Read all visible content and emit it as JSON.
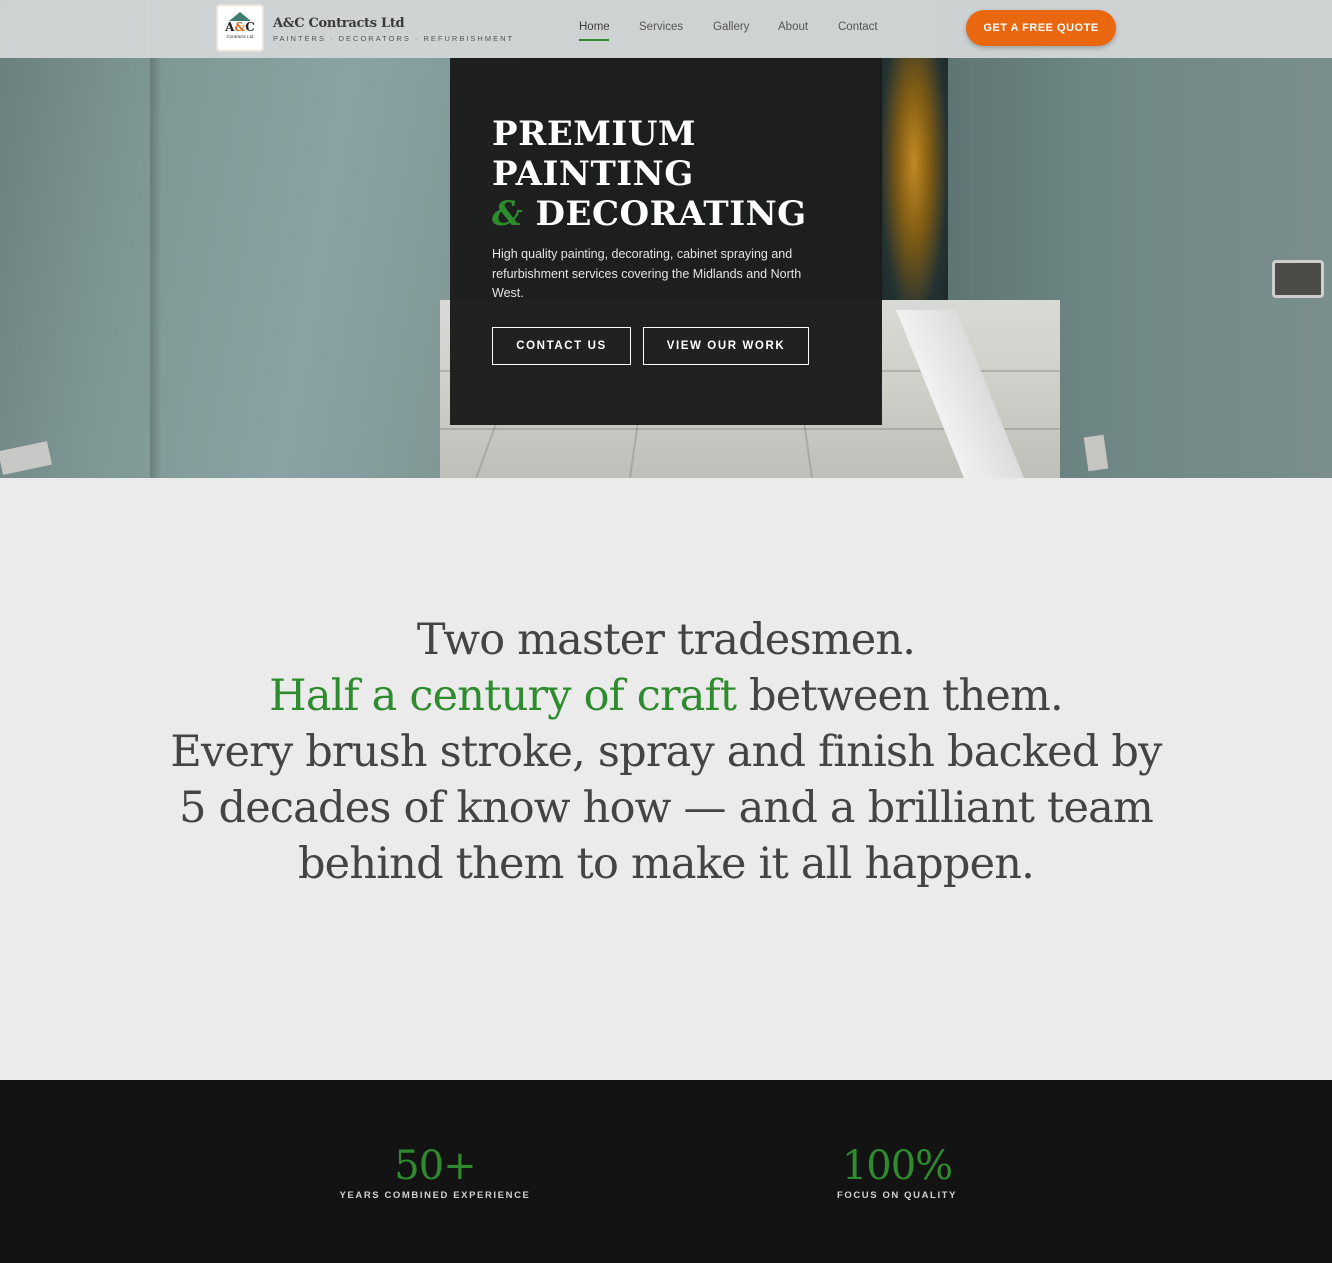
{
  "header": {
    "logo_mark_left": "A",
    "logo_mark_amp": "&",
    "logo_mark_right": "C",
    "logo_small": "Contracts Ltd",
    "brand_name": "A&C Contracts Ltd",
    "brand_tagline": "PAINTERS · DECORATORS · REFURBISHMENT",
    "nav": [
      "Home",
      "Services",
      "Gallery",
      "About",
      "Contact"
    ],
    "active_nav": "Home",
    "cta_label": "GET A FREE QUOTE"
  },
  "hero": {
    "title_line1": "PREMIUM",
    "title_line2": "PAINTING",
    "title_amp": "&",
    "title_line3": "DECORATING",
    "description": "High quality painting, decorating, cabinet spraying and refurbishment services covering the Midlands and North West.",
    "primary_button": "CONTACT US",
    "secondary_button": "VIEW OUR WORK"
  },
  "mission": {
    "line1": "Two master tradesmen.",
    "highlight": "Half a century of craft",
    "line2_rest": " between them.",
    "line3": "Every brush stroke, spray and finish backed by 5 decades of know how — and a brilliant team behind them to make it all happen."
  },
  "stats": [
    {
      "value": "50+",
      "label": "YEARS COMBINED EXPERIENCE"
    },
    {
      "value": "100%",
      "label": "FOCUS ON QUALITY"
    }
  ],
  "colors": {
    "accent_green": "#2e8b2e",
    "cta_orange": "#e8670f",
    "dark_panel": "#1b1b1b",
    "stats_bg": "#131313"
  }
}
